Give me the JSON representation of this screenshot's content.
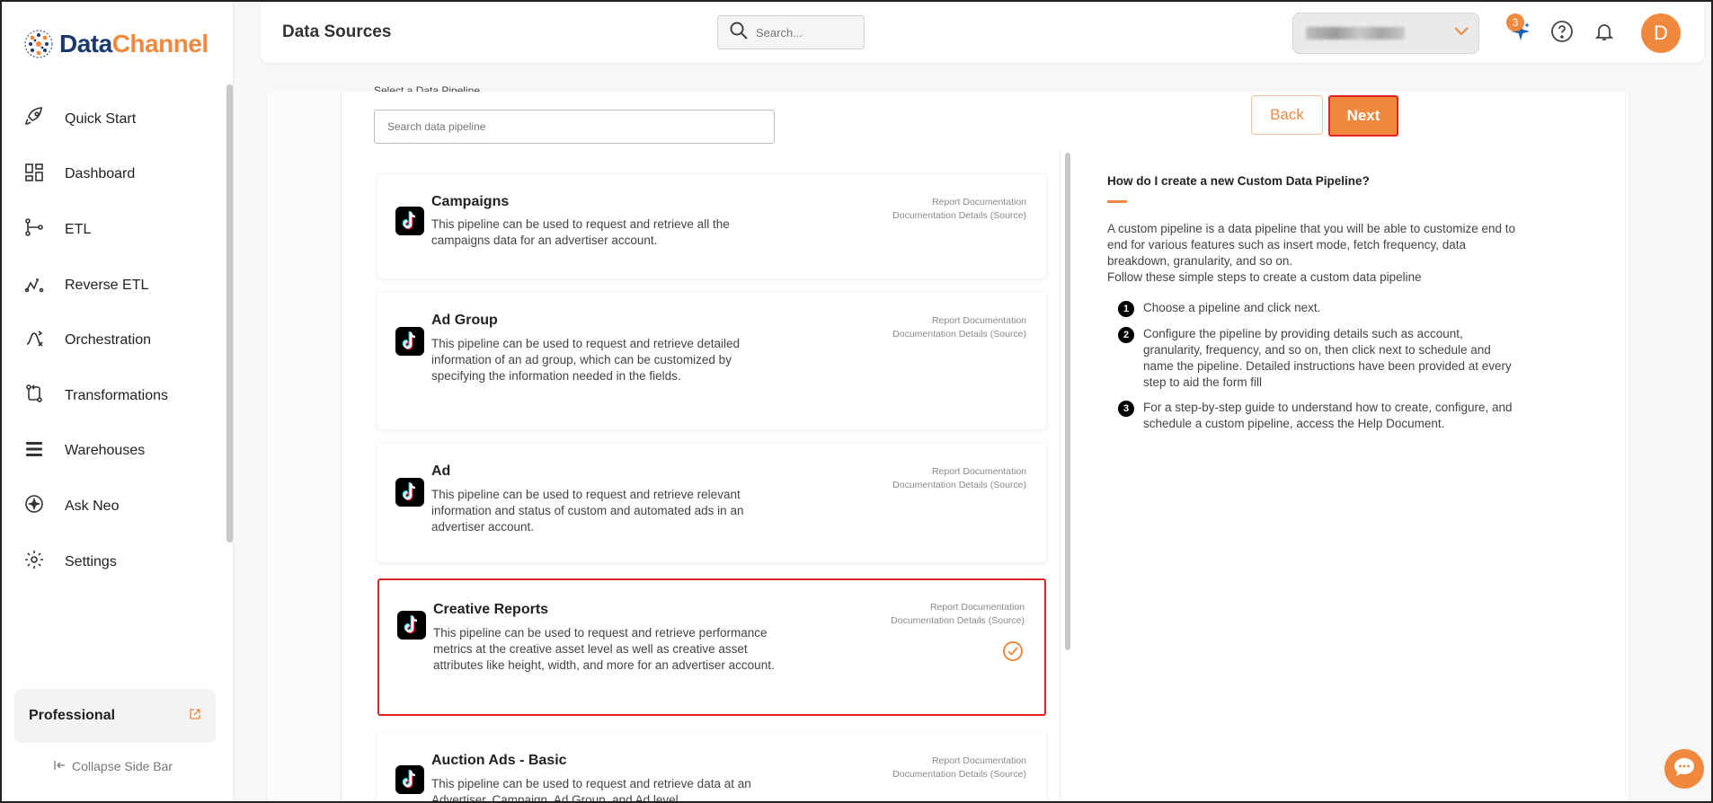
{
  "brand": {
    "logo_part1": "Data",
    "logo_part2": "Channel"
  },
  "sidebar": {
    "items": [
      {
        "label": "Quick Start",
        "icon": "rocket-icon"
      },
      {
        "label": "Dashboard",
        "icon": "dashboard-icon"
      },
      {
        "label": "ETL",
        "icon": "etl-icon"
      },
      {
        "label": "Reverse ETL",
        "icon": "reverse-etl-icon"
      },
      {
        "label": "Orchestration",
        "icon": "orchestration-icon"
      },
      {
        "label": "Transformations",
        "icon": "transformations-icon"
      },
      {
        "label": "Warehouses",
        "icon": "warehouses-icon"
      },
      {
        "label": "Ask Neo",
        "icon": "sparkle-icon"
      },
      {
        "label": "Settings",
        "icon": "gear-icon"
      }
    ],
    "plan": "Professional",
    "collapse_label": "Collapse Side Bar"
  },
  "header": {
    "title": "Data Sources",
    "search_placeholder": "Search...",
    "notification_count": "3",
    "avatar_initial": "D"
  },
  "main": {
    "section_label": "Select a Data Pipeline",
    "pipeline_search_placeholder": "Search data pipeline",
    "back_label": "Back",
    "next_label": "Next",
    "pipelines": [
      {
        "title": "Campaigns",
        "description": "This pipeline can be used to request and retrieve all the campaigns data for an advertiser account.",
        "link1": "Report Documentation",
        "link2": "Documentation Details (Source)",
        "selected": false
      },
      {
        "title": "Ad Group",
        "description": "This pipeline can be used to request and retrieve detailed information of an ad group, which can be customized by specifying the information needed in the fields.",
        "link1": "Report Documentation",
        "link2": "Documentation Details (Source)",
        "selected": false
      },
      {
        "title": "Ad",
        "description": "This pipeline can be used to request and retrieve relevant information and status of custom and automated ads in an advertiser account.",
        "link1": "Report Documentation",
        "link2": "Documentation Details (Source)",
        "selected": false
      },
      {
        "title": "Creative Reports",
        "description": "This pipeline can be used to request and retrieve performance metrics at the creative asset level as well as creative asset attributes like height, width, and more for an advertiser account.",
        "link1": "Report Documentation",
        "link2": "Documentation Details (Source)",
        "selected": true
      },
      {
        "title": "Auction Ads - Basic",
        "description": "This pipeline can be used to request and retrieve data at an Advertiser, Campaign, Ad Group, and Ad level.",
        "link1": "Report Documentation",
        "link2": "Documentation Details (Source)",
        "selected": false
      }
    ]
  },
  "help": {
    "question": "How do I create a new Custom Data Pipeline?",
    "intro": "A custom pipeline is a data pipeline that you will be able to customize end to end for various features such as insert mode, fetch frequency, data breakdown, granularity, and so on.",
    "follow": "Follow these simple steps to create a custom data pipeline",
    "steps": [
      {
        "num": "1",
        "text": "Choose a pipeline and click next."
      },
      {
        "num": "2",
        "text": "Configure the pipeline by providing details such as account, granularity, frequency, and so on, then click next to schedule and name the pipeline. Detailed instructions have been provided at every step to aid the form fill"
      },
      {
        "num": "3",
        "text": "For a step-by-step guide to understand how to create, configure, and schedule a custom pipeline, access the Help Document."
      }
    ]
  },
  "colors": {
    "accent": "#f0893e",
    "selection": "#e02424",
    "brand_dark": "#1b3a6b"
  }
}
